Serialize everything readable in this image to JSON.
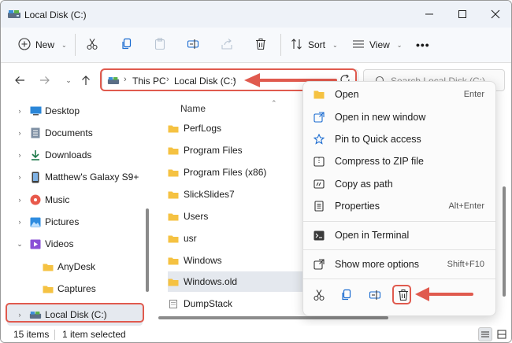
{
  "window": {
    "title": "Local Disk (C:)"
  },
  "toolbar": {
    "new_label": "New",
    "sort_label": "Sort",
    "view_label": "View"
  },
  "address": {
    "crumbs": [
      "This PC",
      "Local Disk (C:)"
    ],
    "search_placeholder": "Search Local Disk (C:)"
  },
  "sidebar": {
    "items": [
      {
        "label": "Desktop",
        "icon": "desktop-icon",
        "chevron": "›"
      },
      {
        "label": "Documents",
        "icon": "documents-icon",
        "chevron": "›"
      },
      {
        "label": "Downloads",
        "icon": "downloads-icon",
        "chevron": "›"
      },
      {
        "label": "Matthew's Galaxy S9+",
        "icon": "phone-icon",
        "chevron": "›"
      },
      {
        "label": "Music",
        "icon": "music-icon",
        "chevron": "›"
      },
      {
        "label": "Pictures",
        "icon": "pictures-icon",
        "chevron": "›"
      },
      {
        "label": "Videos",
        "icon": "videos-icon",
        "chevron": "⌄"
      },
      {
        "label": "AnyDesk",
        "icon": "folder-icon",
        "chevron": ""
      },
      {
        "label": "Captures",
        "icon": "folder-icon",
        "chevron": ""
      },
      {
        "label": "Local Disk (C:)",
        "icon": "drive-icon",
        "chevron": "›"
      }
    ]
  },
  "files": {
    "column_name": "Name",
    "rows": [
      {
        "name": "PerfLogs",
        "type": "folder"
      },
      {
        "name": "Program Files",
        "type": "folder"
      },
      {
        "name": "Program Files (x86)",
        "type": "folder"
      },
      {
        "name": "SlickSlides7",
        "type": "folder"
      },
      {
        "name": "Users",
        "type": "folder"
      },
      {
        "name": "usr",
        "type": "folder"
      },
      {
        "name": "Windows",
        "type": "folder"
      },
      {
        "name": "Windows.old",
        "type": "folder",
        "selected": true
      },
      {
        "name": "DumpStack",
        "type": "file"
      }
    ]
  },
  "context_menu": {
    "items": [
      {
        "label": "Open",
        "shortcut": "Enter",
        "icon": "open-icon"
      },
      {
        "label": "Open in new window",
        "shortcut": "",
        "icon": "new-window-icon"
      },
      {
        "label": "Pin to Quick access",
        "shortcut": "",
        "icon": "star-icon"
      },
      {
        "label": "Compress to ZIP file",
        "shortcut": "",
        "icon": "zip-icon"
      },
      {
        "label": "Copy as path",
        "shortcut": "",
        "icon": "copy-path-icon"
      },
      {
        "label": "Properties",
        "shortcut": "Alt+Enter",
        "icon": "properties-icon"
      },
      {
        "label": "Open in Terminal",
        "shortcut": "",
        "icon": "terminal-icon"
      },
      {
        "label": "Show more options",
        "shortcut": "Shift+F10",
        "icon": "more-options-icon"
      }
    ]
  },
  "status": {
    "count": "15 items",
    "selection": "1 item selected"
  },
  "colors": {
    "highlight": "#e05a4e",
    "folder": "#f5c242",
    "accent": "#0a63c9"
  }
}
